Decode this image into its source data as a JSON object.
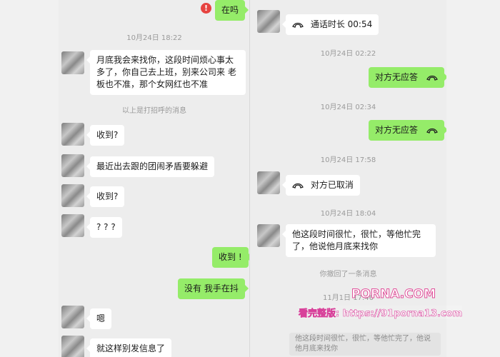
{
  "left_chat": {
    "top_sent": "在吗",
    "error_mark": "!",
    "ts1": "10月24日 18:22",
    "msg1": "月底我会来找你，这段时间烦心事太多了，你自己去上班，别来公司来 老板也不准，那个女网红也不准",
    "greeting_notice": "以上是打招呼的消息",
    "msg2": "收到?",
    "msg3": "最近出去跟的团闹矛盾要躲避",
    "msg4": "收到?",
    "msg5": "? ? ?",
    "sent1": "收到 !",
    "sent2": "没有 我手在抖",
    "msg6": "嗯",
    "msg7": "就这样别发信息了"
  },
  "right_chat": {
    "call1": "通话时长 00:54",
    "ts1": "10月24日 02:22",
    "call2": "对方无应答",
    "ts2": "10月24日 02:34",
    "call3": "对方无应答",
    "ts3": "10月24日 17:58",
    "call4": "对方已取消",
    "ts4": "10月24日 18:04",
    "msg1": "他这段时间很忙，很忙，等他忙完了，他说他月底来找你",
    "recall_notice": "你撤回了一条消息",
    "ts5": "11月1日 17:46",
    "quote_text": "他这段时间很忙，很忙，等他忙完了，他说他月底来找你"
  },
  "watermark": {
    "logo": "PORNA.COM",
    "line": "看完整版: https://91porna13.com"
  },
  "colors": {
    "sent_bubble": "#95ec69",
    "recv_bubble": "#ffffff",
    "background": "#ededed",
    "error": "#e64340"
  }
}
